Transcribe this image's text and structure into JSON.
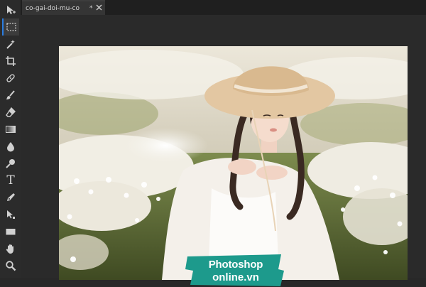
{
  "document": {
    "tab_title": "co-gai-doi-mu-co",
    "modified_marker": "*",
    "close_icon": "close-icon"
  },
  "toolbar": {
    "tools": [
      {
        "name": "move-tool",
        "icon": "move-arrow-icon"
      },
      {
        "name": "marquee-tool",
        "icon": "rect-marquee-icon",
        "active": true
      },
      {
        "name": "magic-wand-tool",
        "icon": "magic-wand-icon"
      },
      {
        "name": "crop-tool",
        "icon": "crop-icon"
      },
      {
        "name": "healing-tool",
        "icon": "bandage-icon"
      },
      {
        "name": "brush-tool",
        "icon": "brush-icon"
      },
      {
        "name": "eraser-tool",
        "icon": "eraser-icon"
      },
      {
        "name": "gradient-tool",
        "icon": "gradient-icon"
      },
      {
        "name": "blur-tool",
        "icon": "drop-icon"
      },
      {
        "name": "dodge-tool",
        "icon": "dodge-icon"
      },
      {
        "name": "type-tool",
        "icon": "type-icon",
        "glyph": "T"
      },
      {
        "name": "pen-tool",
        "icon": "pen-icon"
      },
      {
        "name": "path-select-tool",
        "icon": "path-select-icon"
      },
      {
        "name": "shape-tool",
        "icon": "rectangle-shape-icon"
      },
      {
        "name": "hand-tool",
        "icon": "hand-icon"
      },
      {
        "name": "zoom-tool",
        "icon": "zoom-icon"
      }
    ]
  },
  "watermark": {
    "line1": "Photoshop",
    "line2": "online.vn",
    "color": "#1d9a8c"
  },
  "colors": {
    "accent": "#2a7de1",
    "ui_background": "#282828",
    "icon": "#d0d0d0"
  }
}
